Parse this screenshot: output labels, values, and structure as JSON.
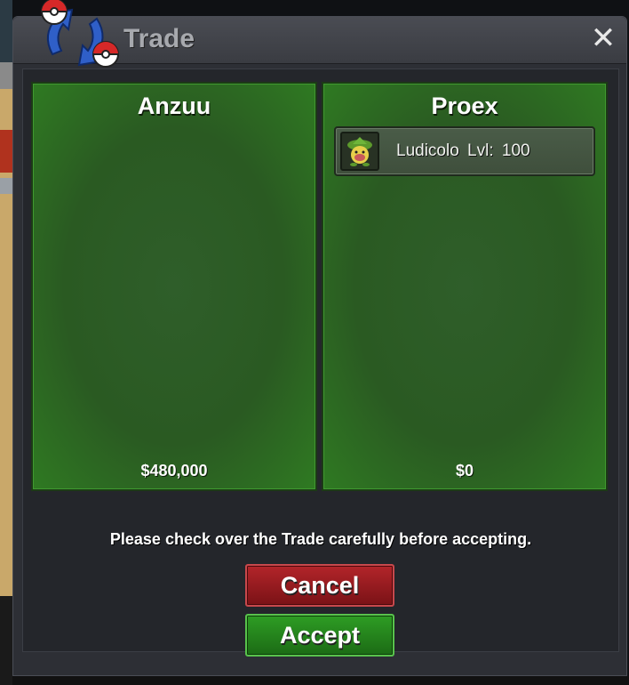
{
  "window": {
    "title": "Trade",
    "close_label": "✕"
  },
  "left_panel": {
    "player": "Anzuu",
    "money": "$480,000",
    "items": []
  },
  "right_panel": {
    "player": "Proex",
    "money": "$0",
    "items": [
      {
        "label": "Ludicolo  Lvl: 100",
        "icon": "ludicolo-sprite-icon"
      }
    ]
  },
  "notice": "Please check over the Trade carefully before accepting.",
  "buttons": {
    "cancel": "Cancel",
    "accept": "Accept"
  },
  "colors": {
    "panel_green": "#2f7a22",
    "cancel_red": "#b3252a",
    "accept_green": "#2e9d24"
  }
}
